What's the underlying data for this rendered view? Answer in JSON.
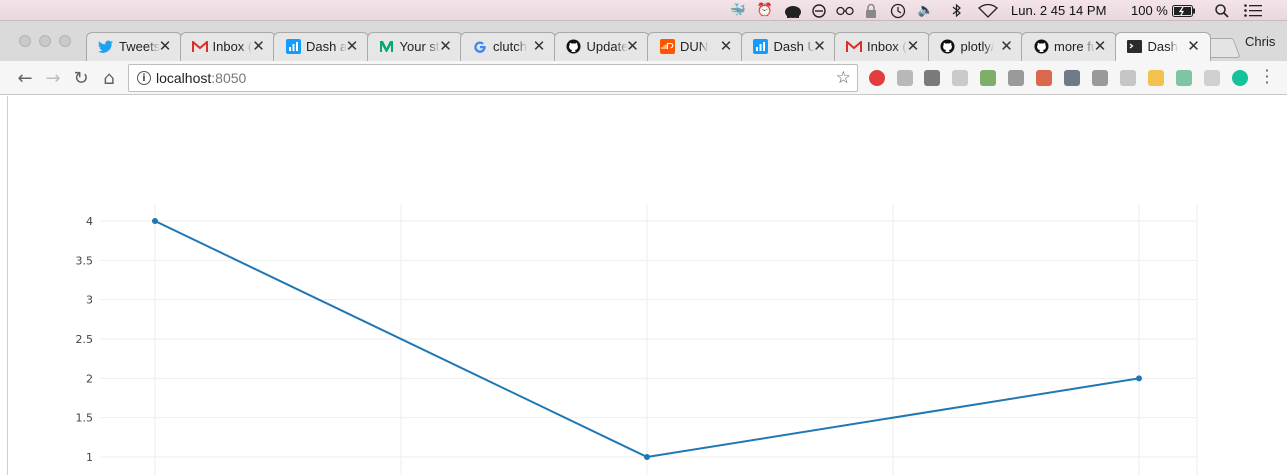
{
  "menubar": {
    "icons": [
      "docker-icon",
      "alarm-icon",
      "evernote-elephant-icon",
      "circle-slash-icon",
      "glasses-icon",
      "lock-icon",
      "history-clock-icon",
      "volume-icon",
      "bluetooth-icon",
      "wifi-icon"
    ],
    "datetime": "Lun. 2 45 14 PM",
    "battery": "100 %",
    "search_icon": "search-icon",
    "list_icon": "list-icon"
  },
  "tabs": [
    {
      "title": "Tweets",
      "icon": "twitter-icon",
      "color": "#1da1f2"
    },
    {
      "title": "Inbox (",
      "icon": "gmail-icon",
      "color": "#d93025"
    },
    {
      "title": "Dash a",
      "icon": "dash-icon",
      "color": "#119dff"
    },
    {
      "title": "Your st",
      "icon": "medium-icon",
      "color": "#00ab6c"
    },
    {
      "title": "clutch",
      "icon": "google-icon",
      "color": "#4285f4"
    },
    {
      "title": "Update",
      "icon": "github-icon",
      "color": "#111111"
    },
    {
      "title": "DUN",
      "icon": "soundcloud-icon",
      "color": "#ff5500"
    },
    {
      "title": "Dash U",
      "icon": "dash-icon",
      "color": "#119dff"
    },
    {
      "title": "Inbox (",
      "icon": "gmail-icon",
      "color": "#d93025"
    },
    {
      "title": "plotly/",
      "icon": "github-icon",
      "color": "#111111"
    },
    {
      "title": "more fu",
      "icon": "github-icon",
      "color": "#111111"
    },
    {
      "title": "Dash",
      "icon": "terminal-icon",
      "color": "#2b2b2b"
    }
  ],
  "active_tab": 11,
  "profile_name": "Chris",
  "omnibox": {
    "host": "localhost",
    "port": ":8050"
  },
  "extensions": [
    {
      "name": "opera-icon",
      "color": "#e23c3c"
    },
    {
      "name": "ext-gray-icon",
      "color": "#b8b8b8"
    },
    {
      "name": "evernote-icon",
      "color": "#7a7a7a"
    },
    {
      "name": "feather-icon",
      "color": "#c9c9c9"
    },
    {
      "name": "plant-icon",
      "color": "#7fae6a"
    },
    {
      "name": "camera-icon",
      "color": "#9a9a9a"
    },
    {
      "name": "book-icon",
      "color": "#d9684f"
    },
    {
      "name": "folder-icon",
      "color": "#6f7a89"
    },
    {
      "name": "clipboard-icon",
      "color": "#9a9a9a"
    },
    {
      "name": "g-icon",
      "color": "#c6c6c6"
    },
    {
      "name": "dots-icon",
      "color": "#f2c14e"
    },
    {
      "name": "r-icon",
      "color": "#7ec4a5"
    },
    {
      "name": "pdf-icon",
      "color": "#d0d0d0"
    },
    {
      "name": "grammarly-icon",
      "color": "#15c39a"
    }
  ],
  "chart_data": {
    "type": "line",
    "x": [
      1,
      2,
      3
    ],
    "y": [
      4,
      1,
      2
    ],
    "series": [
      {
        "values": [
          4,
          1,
          2
        ],
        "color": "#1f77b4"
      }
    ],
    "yticks": [
      "4",
      "3.5",
      "3",
      "2.5",
      "2",
      "1.5",
      "1"
    ],
    "ytick_values": [
      4,
      3.5,
      3,
      2.5,
      2,
      1.5,
      1
    ],
    "grid": true,
    "title": "",
    "xlabel": "",
    "ylabel": ""
  }
}
